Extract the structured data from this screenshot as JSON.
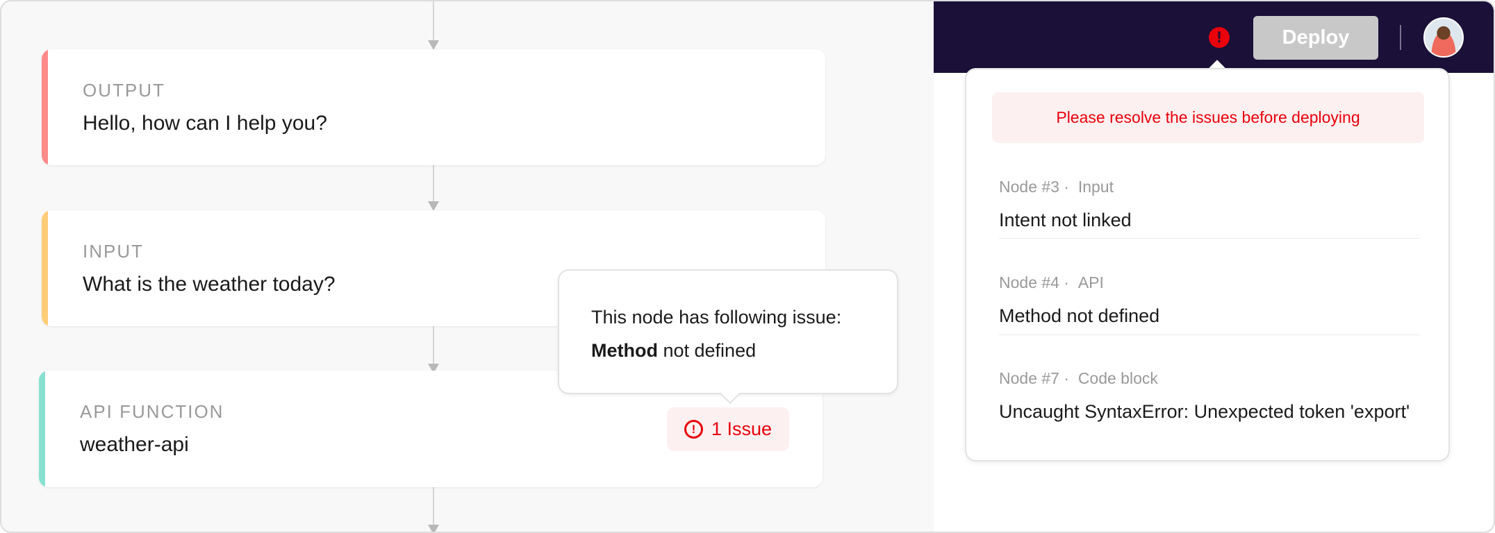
{
  "canvas": {
    "nodes": [
      {
        "label": "OUTPUT",
        "value": "Hello, how can I help you?",
        "color": "#ff8a8a"
      },
      {
        "label": "INPUT",
        "value": "What is the weather today?",
        "color": "#ffcc77"
      },
      {
        "label": "API FUNCTION",
        "value": "weather-api",
        "color": "#88e0d0"
      }
    ],
    "tooltip": {
      "line1": "This node has following issue:",
      "bold": "Method",
      "rest": " not defined"
    },
    "issue_badge": {
      "icon": "alert-circle-icon",
      "label": "1 Issue"
    }
  },
  "header": {
    "error_icon": "alert-icon",
    "deploy_label": "Deploy",
    "avatar": "user-avatar"
  },
  "issues_popover": {
    "alert": "Please resolve the issues before deploying",
    "items": [
      {
        "node": "Node #3",
        "type": "Input",
        "message": "Intent not linked"
      },
      {
        "node": "Node #4",
        "type": "API",
        "message": "Method not defined"
      },
      {
        "node": "Node #7",
        "type": "Code block",
        "message": "Uncaught SyntaxError: Unexpected token 'export'"
      }
    ]
  },
  "colors": {
    "header_bg": "#1a1038",
    "error": "#e8000b",
    "deploy_disabled": "#c8c8c8"
  }
}
